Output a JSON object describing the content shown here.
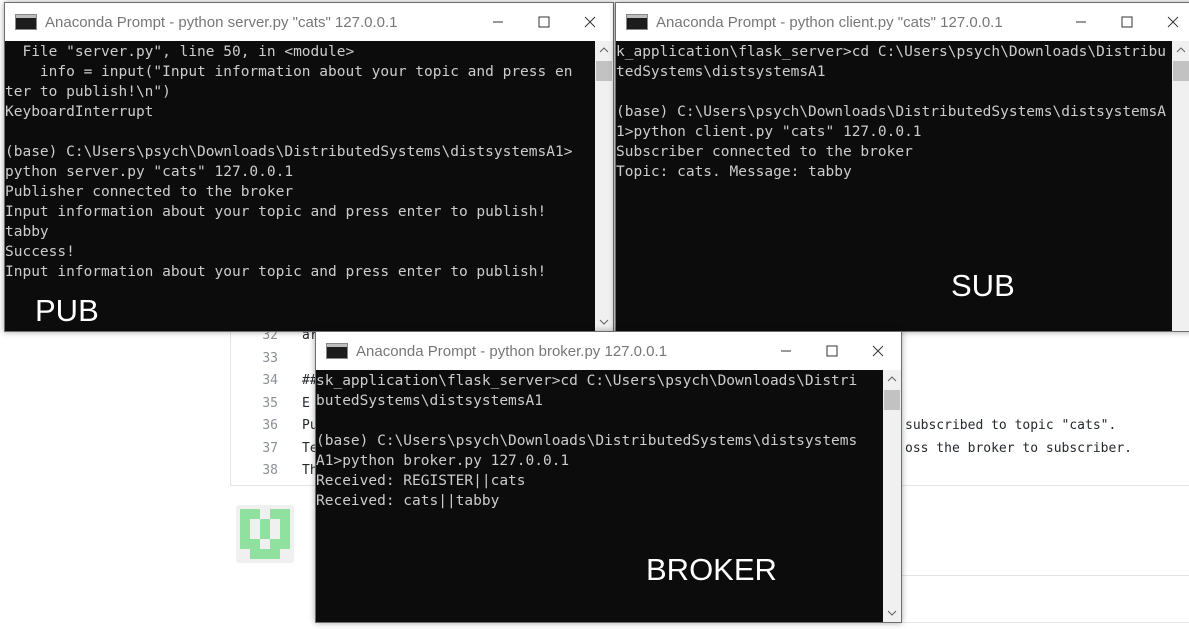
{
  "background": {
    "line_numbers": [
      "32",
      "33",
      "34",
      "35",
      "36",
      "37",
      "38"
    ],
    "code_fragments": [
      "ar",
      "",
      "##",
      "E",
      "Pu",
      "Te",
      "Th"
    ],
    "right_fragments": [
      "subscribed to topic \"cats\".",
      "oss the broker to subscriber."
    ]
  },
  "windows": {
    "pub": {
      "title": "Anaconda Prompt - python  server.py \"cats\" 127.0.0.1",
      "lines": [
        "  File \"server.py\", line 50, in <module>",
        "    info = input(\"Input information about your topic and press en",
        "ter to publish!\\n\")",
        "KeyboardInterrupt",
        "",
        "(base) C:\\Users\\psych\\Downloads\\DistributedSystems\\distsystemsA1>",
        "python server.py \"cats\" 127.0.0.1",
        "Publisher connected to the broker",
        "Input information about your topic and press enter to publish!",
        "tabby",
        "Success!",
        "Input information about your topic and press enter to publish!"
      ],
      "label": "PUB"
    },
    "sub": {
      "title": "Anaconda Prompt - python  client.py \"cats\" 127.0.0.1",
      "lines": [
        "k_application\\flask_server>cd C:\\Users\\psych\\Downloads\\Distribu",
        "tedSystems\\distsystemsA1",
        "",
        "(base) C:\\Users\\psych\\Downloads\\DistributedSystems\\distsystemsA",
        "1>python client.py \"cats\" 127.0.0.1",
        "Subscriber connected to the broker",
        "Topic: cats. Message: tabby"
      ],
      "label": "SUB"
    },
    "broker": {
      "title": "Anaconda Prompt - python  broker.py 127.0.0.1",
      "lines": [
        "sk_application\\flask_server>cd C:\\Users\\psych\\Downloads\\Distri",
        "butedSystems\\distsystemsA1",
        "",
        "(base) C:\\Users\\psych\\Downloads\\DistributedSystems\\distsystems",
        "A1>python broker.py 127.0.0.1",
        "Received: REGISTER||cats",
        "Received: cats||tabby"
      ],
      "label": "BROKER"
    }
  },
  "colors": {
    "console_bg": "#0c0c0c",
    "console_text": "#cccccc",
    "label_text": "#ffffff",
    "avatar_green": "#90e0a0"
  },
  "icons": [
    "cmd-window-icon",
    "minimize-icon",
    "maximize-icon",
    "close-icon",
    "scroll-up-icon",
    "scroll-down-icon",
    "identicon-avatar"
  ]
}
